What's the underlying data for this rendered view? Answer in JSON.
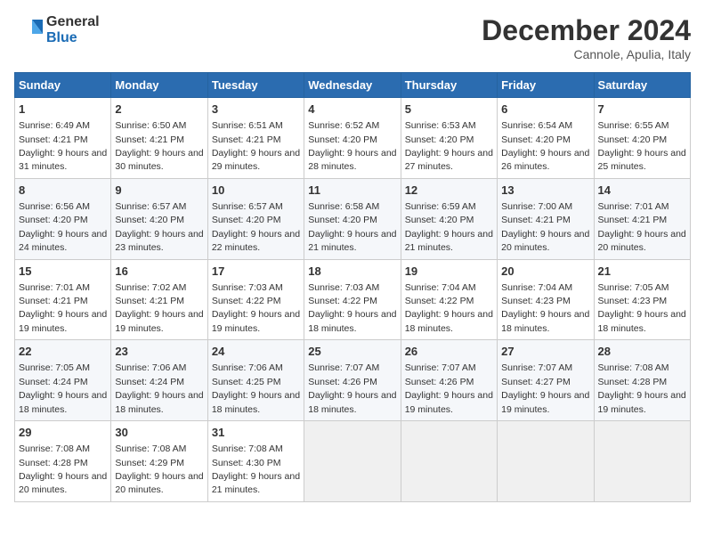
{
  "logo": {
    "general": "General",
    "blue": "Blue"
  },
  "title": "December 2024",
  "subtitle": "Cannole, Apulia, Italy",
  "days_header": [
    "Sunday",
    "Monday",
    "Tuesday",
    "Wednesday",
    "Thursday",
    "Friday",
    "Saturday"
  ],
  "weeks": [
    [
      {
        "day": "1",
        "sunrise": "6:49 AM",
        "sunset": "4:21 PM",
        "daylight": "9 hours and 31 minutes."
      },
      {
        "day": "2",
        "sunrise": "6:50 AM",
        "sunset": "4:21 PM",
        "daylight": "9 hours and 30 minutes."
      },
      {
        "day": "3",
        "sunrise": "6:51 AM",
        "sunset": "4:21 PM",
        "daylight": "9 hours and 29 minutes."
      },
      {
        "day": "4",
        "sunrise": "6:52 AM",
        "sunset": "4:20 PM",
        "daylight": "9 hours and 28 minutes."
      },
      {
        "day": "5",
        "sunrise": "6:53 AM",
        "sunset": "4:20 PM",
        "daylight": "9 hours and 27 minutes."
      },
      {
        "day": "6",
        "sunrise": "6:54 AM",
        "sunset": "4:20 PM",
        "daylight": "9 hours and 26 minutes."
      },
      {
        "day": "7",
        "sunrise": "6:55 AM",
        "sunset": "4:20 PM",
        "daylight": "9 hours and 25 minutes."
      }
    ],
    [
      {
        "day": "8",
        "sunrise": "6:56 AM",
        "sunset": "4:20 PM",
        "daylight": "9 hours and 24 minutes."
      },
      {
        "day": "9",
        "sunrise": "6:57 AM",
        "sunset": "4:20 PM",
        "daylight": "9 hours and 23 minutes."
      },
      {
        "day": "10",
        "sunrise": "6:57 AM",
        "sunset": "4:20 PM",
        "daylight": "9 hours and 22 minutes."
      },
      {
        "day": "11",
        "sunrise": "6:58 AM",
        "sunset": "4:20 PM",
        "daylight": "9 hours and 21 minutes."
      },
      {
        "day": "12",
        "sunrise": "6:59 AM",
        "sunset": "4:20 PM",
        "daylight": "9 hours and 21 minutes."
      },
      {
        "day": "13",
        "sunrise": "7:00 AM",
        "sunset": "4:21 PM",
        "daylight": "9 hours and 20 minutes."
      },
      {
        "day": "14",
        "sunrise": "7:01 AM",
        "sunset": "4:21 PM",
        "daylight": "9 hours and 20 minutes."
      }
    ],
    [
      {
        "day": "15",
        "sunrise": "7:01 AM",
        "sunset": "4:21 PM",
        "daylight": "9 hours and 19 minutes."
      },
      {
        "day": "16",
        "sunrise": "7:02 AM",
        "sunset": "4:21 PM",
        "daylight": "9 hours and 19 minutes."
      },
      {
        "day": "17",
        "sunrise": "7:03 AM",
        "sunset": "4:22 PM",
        "daylight": "9 hours and 19 minutes."
      },
      {
        "day": "18",
        "sunrise": "7:03 AM",
        "sunset": "4:22 PM",
        "daylight": "9 hours and 18 minutes."
      },
      {
        "day": "19",
        "sunrise": "7:04 AM",
        "sunset": "4:22 PM",
        "daylight": "9 hours and 18 minutes."
      },
      {
        "day": "20",
        "sunrise": "7:04 AM",
        "sunset": "4:23 PM",
        "daylight": "9 hours and 18 minutes."
      },
      {
        "day": "21",
        "sunrise": "7:05 AM",
        "sunset": "4:23 PM",
        "daylight": "9 hours and 18 minutes."
      }
    ],
    [
      {
        "day": "22",
        "sunrise": "7:05 AM",
        "sunset": "4:24 PM",
        "daylight": "9 hours and 18 minutes."
      },
      {
        "day": "23",
        "sunrise": "7:06 AM",
        "sunset": "4:24 PM",
        "daylight": "9 hours and 18 minutes."
      },
      {
        "day": "24",
        "sunrise": "7:06 AM",
        "sunset": "4:25 PM",
        "daylight": "9 hours and 18 minutes."
      },
      {
        "day": "25",
        "sunrise": "7:07 AM",
        "sunset": "4:26 PM",
        "daylight": "9 hours and 18 minutes."
      },
      {
        "day": "26",
        "sunrise": "7:07 AM",
        "sunset": "4:26 PM",
        "daylight": "9 hours and 19 minutes."
      },
      {
        "day": "27",
        "sunrise": "7:07 AM",
        "sunset": "4:27 PM",
        "daylight": "9 hours and 19 minutes."
      },
      {
        "day": "28",
        "sunrise": "7:08 AM",
        "sunset": "4:28 PM",
        "daylight": "9 hours and 19 minutes."
      }
    ],
    [
      {
        "day": "29",
        "sunrise": "7:08 AM",
        "sunset": "4:28 PM",
        "daylight": "9 hours and 20 minutes."
      },
      {
        "day": "30",
        "sunrise": "7:08 AM",
        "sunset": "4:29 PM",
        "daylight": "9 hours and 20 minutes."
      },
      {
        "day": "31",
        "sunrise": "7:08 AM",
        "sunset": "4:30 PM",
        "daylight": "9 hours and 21 minutes."
      },
      null,
      null,
      null,
      null
    ]
  ]
}
